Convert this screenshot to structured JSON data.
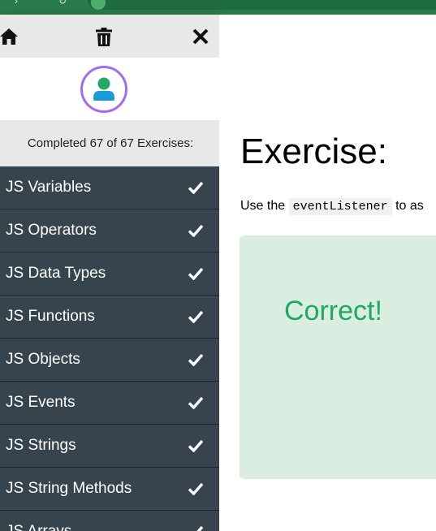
{
  "browser": {
    "url_fragment": "/s, ...g...p...",
    "tab_fragment": "...g_..."
  },
  "toolbar": {
    "home_icon": "home-icon",
    "trash_icon": "trash-icon",
    "close_icon": "close-icon"
  },
  "avatar": {
    "icon": "user-icon",
    "ring_color": "#a36cf0",
    "fill_color": "#1a9bd7"
  },
  "progress": {
    "text": "Completed 67 of 67 Exercises:",
    "completed": 67,
    "total": 67
  },
  "exercises": [
    {
      "label": "JS Variables",
      "done": true
    },
    {
      "label": "JS Operators",
      "done": true
    },
    {
      "label": "JS Data Types",
      "done": true
    },
    {
      "label": "JS Functions",
      "done": true
    },
    {
      "label": "JS Objects",
      "done": true
    },
    {
      "label": "JS Events",
      "done": true
    },
    {
      "label": "JS Strings",
      "done": true
    },
    {
      "label": "JS String Methods",
      "done": true
    },
    {
      "label": "JS Arrays",
      "done": true
    }
  ],
  "main": {
    "title": "Exercise:",
    "instruction_prefix": "Use the",
    "instruction_code": "eventListener",
    "instruction_suffix": "to as",
    "result": "Correct!"
  },
  "colors": {
    "sidebar_dark": "#38444d",
    "sidebar_light": "#e8e8e8",
    "correct_bg": "#d9eee1",
    "correct_text": "#1ea861",
    "browser_green": "#2a7a4b"
  }
}
